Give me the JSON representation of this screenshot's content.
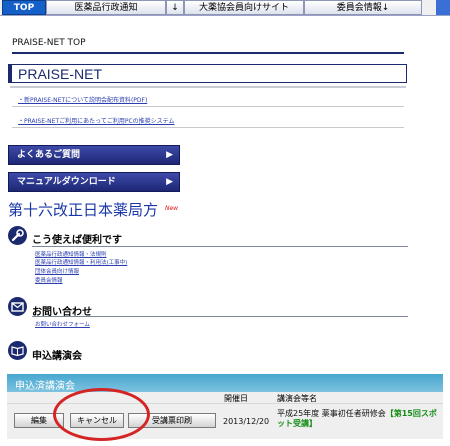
{
  "nav": {
    "tabs": [
      {
        "label": "TOP"
      },
      {
        "label": "医薬品行政通知"
      },
      {
        "label": "↓"
      },
      {
        "label": "大薬協会員向けサイト"
      },
      {
        "label": "委員会情報↓"
      }
    ]
  },
  "page": {
    "heading": "PRAISE-NET TOP",
    "banner_title": "PRAISE-NET"
  },
  "links": {
    "pdf_notice": "・新PRAISE-NETについて説明会配布資料(PDF)",
    "pc_env": "・PRAISE-NETご利用にあたってご利用PCの推奨システム"
  },
  "menu": {
    "faq": "よくあるご質問",
    "manual": "マニュアルダウンロード",
    "arrow": "▶"
  },
  "pharmacopoeia": {
    "title": "第十六改正日本薬局方",
    "badge": "New"
  },
  "sections": {
    "useful": {
      "title": "こう使えば便利です",
      "links": [
        "医薬品行政通知情報・法規則",
        "医薬品行政通知情報・利用法(工事中)",
        "団体会員向け情報",
        "委員会情報"
      ]
    },
    "contact": {
      "title": "お問い合わせ",
      "link": "お問い合わせフォーム"
    },
    "apply": {
      "title": "申込講演会"
    }
  },
  "lectures": {
    "header": "申込済講演会",
    "columns": {
      "date": "開催日",
      "name": "講演会等名"
    },
    "rows": [
      {
        "edit_label": "編集",
        "cancel_label": "キャンセル",
        "print_label": "受講票印刷",
        "date": "2013/12/20",
        "name": "平成25年度 薬事初任者研修会",
        "tag": "【第15回スポット受講】"
      }
    ]
  },
  "colors": {
    "nav_active": "#1460c8",
    "menu_button": "#1d2775",
    "title_blue": "#1a37a8",
    "panel_header": "#48a7cf",
    "highlight_oval": "#d42424",
    "tag_green": "#168c16"
  }
}
